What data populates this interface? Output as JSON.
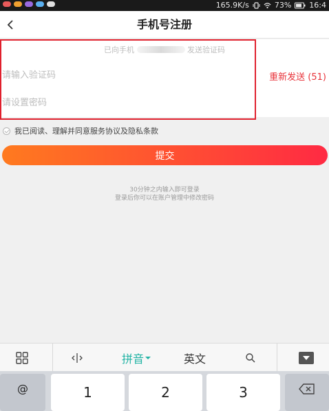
{
  "status_bar": {
    "speed": "165.9K/s",
    "battery": "73%",
    "time": "16:4"
  },
  "header": {
    "title": "手机号注册"
  },
  "form": {
    "hint_prefix": "已向手机",
    "hint_suffix": "发送验证码",
    "code_placeholder": "请输入验证码",
    "password_placeholder": "请设置密码",
    "resend_label": "重新发送 (51)"
  },
  "agreement": {
    "text": "我已阅读、理解并同意服务协议及隐私条款"
  },
  "submit_label": "提交",
  "tips": {
    "line1": "30分钟之内输入即可登录",
    "line2": "登录后你可以在账户管理中修改密码"
  },
  "keyboard": {
    "pinyin_label": "拼音",
    "english_label": "英文",
    "keys": [
      "@",
      "1",
      "2",
      "3"
    ]
  },
  "colors": {
    "accent_red": "#e8333a",
    "button_gradient_start": "#ff7a1f",
    "button_gradient_end": "#ff2a43",
    "pinyin_teal": "#21b3a4",
    "highlight_box": "#e0202d"
  }
}
